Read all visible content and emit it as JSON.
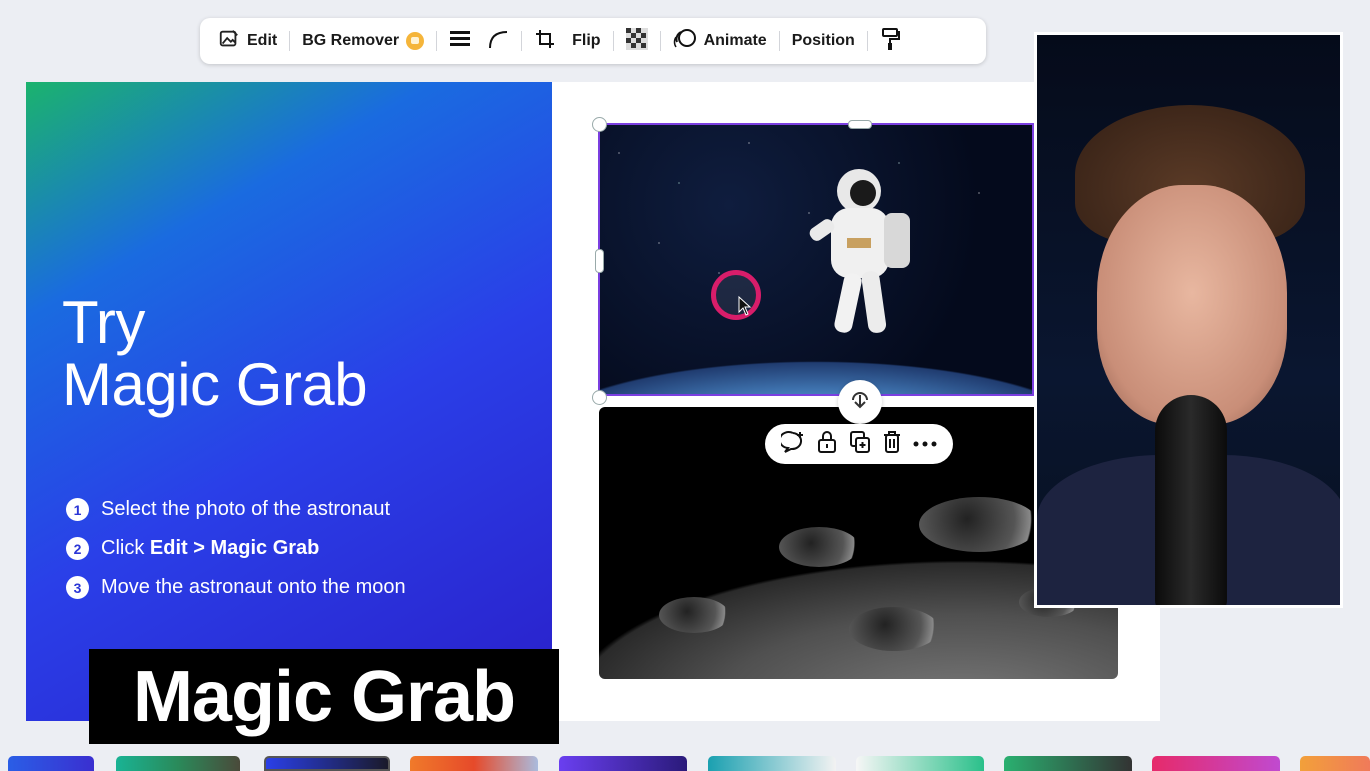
{
  "toolbar": {
    "edit_label": "Edit",
    "bg_remover_label": "BG Remover",
    "flip_label": "Flip",
    "animate_label": "Animate",
    "position_label": "Position"
  },
  "slide": {
    "title_line1": "Try",
    "title_line2": "Magic Grab",
    "steps": [
      {
        "num": "1",
        "pre": "Select the photo of the astronaut",
        "bold": ""
      },
      {
        "num": "2",
        "pre": "Click ",
        "bold": "Edit > Magic Grab"
      },
      {
        "num": "3",
        "pre": "Move the astronaut onto the moon",
        "bold": ""
      }
    ]
  },
  "caption": {
    "text": "Magic Grab"
  },
  "colors": {
    "selection": "#7b3fe0",
    "cursor_ring": "#d81d6a",
    "slide_gradient_start": "#1bb36d",
    "slide_gradient_end": "#2a1fc9"
  },
  "icons": {
    "edit": "image-edit-icon",
    "bg_remover_badge": "crown-icon",
    "border_style": "lines-icon",
    "corner": "corner-radius-icon",
    "crop": "crop-icon",
    "transparency": "checker-icon",
    "animate": "animate-icon",
    "paint": "paint-roller-icon",
    "comment": "comment-plus-icon",
    "lock": "lock-icon",
    "duplicate": "duplicate-icon",
    "delete": "trash-icon",
    "more": "more-icon",
    "rotate": "rotate-icon"
  }
}
